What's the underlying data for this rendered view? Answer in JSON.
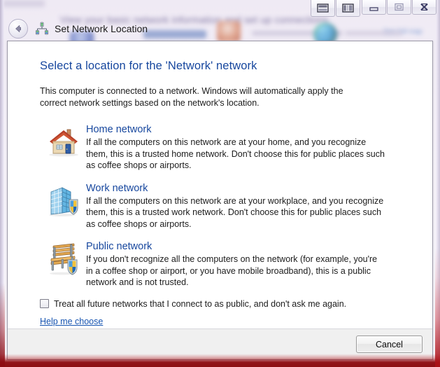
{
  "background_window": {
    "title_text": "View your basic network information and set up connections",
    "link_text": "See full map"
  },
  "window_controls": {
    "buttons": [
      {
        "name": "split-view-button",
        "icon": "split-view-icon"
      },
      {
        "name": "panel-view-button",
        "icon": "panel-view-icon"
      },
      {
        "name": "minimize-button",
        "icon": "minimize-icon"
      },
      {
        "name": "maximize-button",
        "icon": "maximize-icon"
      },
      {
        "name": "close-button",
        "icon": "close-icon"
      }
    ]
  },
  "dialog": {
    "header": {
      "back_icon": "back-arrow-icon",
      "app_icon": "network-icon",
      "title": "Set Network Location"
    },
    "heading": "Select a location for the 'Network' network",
    "intro": "This computer is connected to a network. Windows will automatically apply the correct network settings based on the network's location.",
    "options": [
      {
        "icon": "home-icon",
        "title": "Home network",
        "description": "If all the computers on this network are at your home, and you recognize them, this is a trusted home network.  Don't choose this for public places such as coffee shops or airports."
      },
      {
        "icon": "office-building-shield-icon",
        "title": "Work network",
        "description": "If all the computers on this network are at your workplace, and you recognize them, this is a trusted work network.  Don't choose this for public places such as coffee shops or airports."
      },
      {
        "icon": "park-bench-shield-icon",
        "title": "Public network",
        "description": "If you don't recognize all the computers on the network (for example, you're in a coffee shop or airport, or you have mobile broadband), this is a public network and is not trusted."
      }
    ],
    "checkbox": {
      "label": "Treat all future networks that I connect to as public, and don't ask me again.",
      "checked": false
    },
    "help_link": "Help me choose",
    "footer": {
      "cancel_label": "Cancel"
    }
  },
  "colors": {
    "heading_blue": "#17479e",
    "link_blue": "#1553b0",
    "dialog_bg": "#ffffff",
    "footer_bg": "#f0f0f0",
    "recording_border": "#9d0f14"
  }
}
